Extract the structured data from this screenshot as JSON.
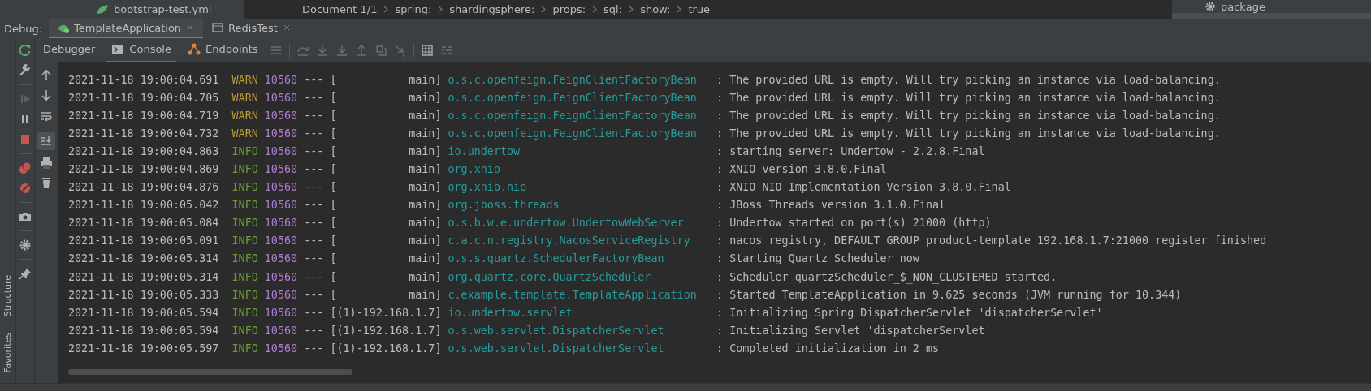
{
  "editor_tab": {
    "file": "bootstrap-test.yml"
  },
  "breadcrumb": [
    "Document 1/1",
    "spring:",
    "shardingsphere:",
    "props:",
    "sql:",
    "show:",
    "true"
  ],
  "side_panel": {
    "items": [
      {
        "label": "package"
      }
    ]
  },
  "debug": {
    "label": "Debug:",
    "tabs": [
      {
        "label": "TemplateApplication",
        "selected": true
      },
      {
        "label": "RedisTest",
        "selected": false
      }
    ]
  },
  "toolbar": {
    "tabs": [
      {
        "label": "Debugger",
        "selected": false
      },
      {
        "label": "Console",
        "selected": true
      },
      {
        "label": "Endpoints",
        "selected": false
      }
    ]
  },
  "console_tools": {
    "soft_wrap": false,
    "scroll_to_end": true
  },
  "side_labels": [
    "Structure",
    "Favorites"
  ],
  "console": {
    "lines": [
      {
        "timestamp": "2021-11-18 19:00:04.691",
        "level": "WARN",
        "pid": "10560",
        "separator": "---",
        "thread": "[           main]",
        "logger": "o.s.c.openfeign.FeignClientFactoryBean",
        "colon": ":",
        "message": "The provided URL is empty. Will try picking an instance via load-balancing."
      },
      {
        "timestamp": "2021-11-18 19:00:04.705",
        "level": "WARN",
        "pid": "10560",
        "separator": "---",
        "thread": "[           main]",
        "logger": "o.s.c.openfeign.FeignClientFactoryBean",
        "colon": ":",
        "message": "The provided URL is empty. Will try picking an instance via load-balancing."
      },
      {
        "timestamp": "2021-11-18 19:00:04.719",
        "level": "WARN",
        "pid": "10560",
        "separator": "---",
        "thread": "[           main]",
        "logger": "o.s.c.openfeign.FeignClientFactoryBean",
        "colon": ":",
        "message": "The provided URL is empty. Will try picking an instance via load-balancing."
      },
      {
        "timestamp": "2021-11-18 19:00:04.732",
        "level": "WARN",
        "pid": "10560",
        "separator": "---",
        "thread": "[           main]",
        "logger": "o.s.c.openfeign.FeignClientFactoryBean",
        "colon": ":",
        "message": "The provided URL is empty. Will try picking an instance via load-balancing."
      },
      {
        "timestamp": "2021-11-18 19:00:04.863",
        "level": "INFO",
        "pid": "10560",
        "separator": "---",
        "thread": "[           main]",
        "logger": "io.undertow",
        "colon": ":",
        "message": "starting server: Undertow - 2.2.8.Final"
      },
      {
        "timestamp": "2021-11-18 19:00:04.869",
        "level": "INFO",
        "pid": "10560",
        "separator": "---",
        "thread": "[           main]",
        "logger": "org.xnio",
        "colon": ":",
        "message": "XNIO version 3.8.0.Final"
      },
      {
        "timestamp": "2021-11-18 19:00:04.876",
        "level": "INFO",
        "pid": "10560",
        "separator": "---",
        "thread": "[           main]",
        "logger": "org.xnio.nio",
        "colon": ":",
        "message": "XNIO NIO Implementation Version 3.8.0.Final"
      },
      {
        "timestamp": "2021-11-18 19:00:05.042",
        "level": "INFO",
        "pid": "10560",
        "separator": "---",
        "thread": "[           main]",
        "logger": "org.jboss.threads",
        "colon": ":",
        "message": "JBoss Threads version 3.1.0.Final"
      },
      {
        "timestamp": "2021-11-18 19:00:05.084",
        "level": "INFO",
        "pid": "10560",
        "separator": "---",
        "thread": "[           main]",
        "logger": "o.s.b.w.e.undertow.UndertowWebServer",
        "colon": ":",
        "message": "Undertow started on port(s) 21000 (http)"
      },
      {
        "timestamp": "2021-11-18 19:00:05.091",
        "level": "INFO",
        "pid": "10560",
        "separator": "---",
        "thread": "[           main]",
        "logger": "c.a.c.n.registry.NacosServiceRegistry",
        "colon": ":",
        "message": "nacos registry, DEFAULT_GROUP product-template 192.168.1.7:21000 register finished"
      },
      {
        "timestamp": "2021-11-18 19:00:05.314",
        "level": "INFO",
        "pid": "10560",
        "separator": "---",
        "thread": "[           main]",
        "logger": "o.s.s.quartz.SchedulerFactoryBean",
        "colon": ":",
        "message": "Starting Quartz Scheduler now"
      },
      {
        "timestamp": "2021-11-18 19:00:05.314",
        "level": "INFO",
        "pid": "10560",
        "separator": "---",
        "thread": "[           main]",
        "logger": "org.quartz.core.QuartzScheduler",
        "colon": ":",
        "message": "Scheduler quartzScheduler_$_NON_CLUSTERED started."
      },
      {
        "timestamp": "2021-11-18 19:00:05.333",
        "level": "INFO",
        "pid": "10560",
        "separator": "---",
        "thread": "[           main]",
        "logger": "c.example.template.TemplateApplication",
        "colon": ":",
        "message": "Started TemplateApplication in 9.625 seconds (JVM running for 10.344)"
      },
      {
        "timestamp": "2021-11-18 19:00:05.594",
        "level": "INFO",
        "pid": "10560",
        "separator": "---",
        "thread": "[(1)-192.168.1.7]",
        "logger": "io.undertow.servlet",
        "colon": ":",
        "message": "Initializing Spring DispatcherServlet 'dispatcherServlet'"
      },
      {
        "timestamp": "2021-11-18 19:00:05.594",
        "level": "INFO",
        "pid": "10560",
        "separator": "---",
        "thread": "[(1)-192.168.1.7]",
        "logger": "o.s.web.servlet.DispatcherServlet",
        "colon": ":",
        "message": "Initializing Servlet 'dispatcherServlet'"
      },
      {
        "timestamp": "2021-11-18 19:00:05.597",
        "level": "INFO",
        "pid": "10560",
        "separator": "---",
        "thread": "[(1)-192.168.1.7]",
        "logger": "o.s.web.servlet.DispatcherServlet",
        "colon": ":",
        "message": "Completed initialization in 2 ms"
      }
    ]
  }
}
